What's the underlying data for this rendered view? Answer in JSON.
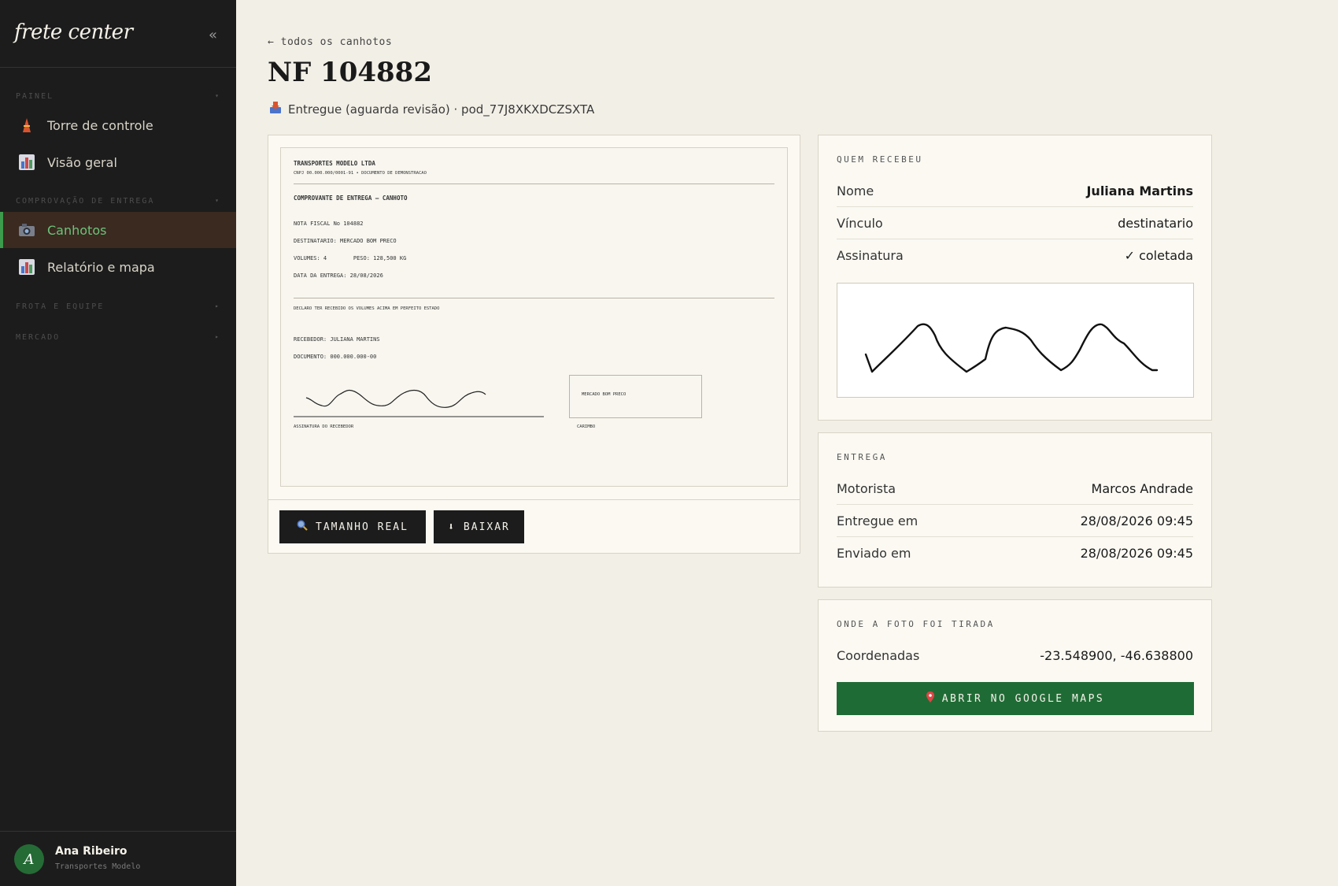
{
  "sidebar": {
    "brand": "frete center",
    "collapse_icon": "«",
    "sections": [
      {
        "label": "PAINEL"
      },
      {
        "label": "COMPROVAÇÃO DE ENTREGA"
      },
      {
        "label": "FROTA E EQUIPE"
      },
      {
        "label": "MERCADO"
      }
    ],
    "items": [
      {
        "label": "Torre de controle",
        "icon": "tower-icon"
      },
      {
        "label": "Visão geral",
        "icon": "bar-chart-icon"
      },
      {
        "label": "Canhotos",
        "icon": "camera-icon",
        "active": true
      },
      {
        "label": "Relatório e mapa",
        "icon": "bar-chart-icon"
      }
    ],
    "user": {
      "initial": "A",
      "name": "Ana Ribeiro",
      "org": "Transportes Modelo"
    }
  },
  "header": {
    "back_link": "← todos os canhotos",
    "title": "NF 104882",
    "status": "Entregue (aguarda revisão) · pod_77J8XKXDCZSXTA"
  },
  "photo": {
    "doc_lines": {
      "company": "TRANSPORTES MODELO LTDA",
      "cnpj": "CNPJ 00.000.000/0001-91  •  DOCUMENTO DE DEMONSTRACAO",
      "heading": "COMPROVANTE DE ENTREGA — CANHOTO",
      "nf": "NOTA FISCAL No 104882",
      "dest": "DESTINATARIO: MERCADO BOM PRECO",
      "volumes": "VOLUMES: 4        PESO: 128,500 KG",
      "date": "DATA DA ENTREGA: 28/08/2026",
      "declaration": "DECLARO TER RECEBIDO OS VOLUMES ACIMA EM PERFEITO ESTADO",
      "receiver": "RECEBEDOR: JULIANA MARTINS",
      "document": "DOCUMENTO: 000.000.000-00",
      "stamp_text": "MERCADO BOM PRECO",
      "sig_caption": "ASSINATURA DO RECEBEDOR",
      "stamp_caption": "CARIMBO"
    },
    "buttons": {
      "real_size": "TAMANHO REAL",
      "download": "BAIXAR"
    }
  },
  "received": {
    "heading": "QUEM RECEBEU",
    "rows": [
      {
        "key": "Nome",
        "value": "Juliana Martins"
      },
      {
        "key": "Vínculo",
        "value": "destinatario"
      },
      {
        "key": "Assinatura",
        "value": "✓ coletada"
      }
    ]
  },
  "delivery": {
    "heading": "ENTREGA",
    "rows": [
      {
        "key": "Motorista",
        "value": "Marcos Andrade"
      },
      {
        "key": "Entregue em",
        "value": "28/08/2026 09:45"
      },
      {
        "key": "Enviado em",
        "value": "28/08/2026 09:45"
      }
    ]
  },
  "location": {
    "heading": "ONDE A FOTO FOI TIRADA",
    "key": "Coordenadas",
    "coords": "-23.548900, -46.638800",
    "button": "ABRIR NO GOOGLE MAPS"
  },
  "colors": {
    "sidebar_bg": "#1c1c1c",
    "active_item": "#6ec27a",
    "accent_green": "#1f6b35",
    "page_bg": "#f2efe6"
  }
}
